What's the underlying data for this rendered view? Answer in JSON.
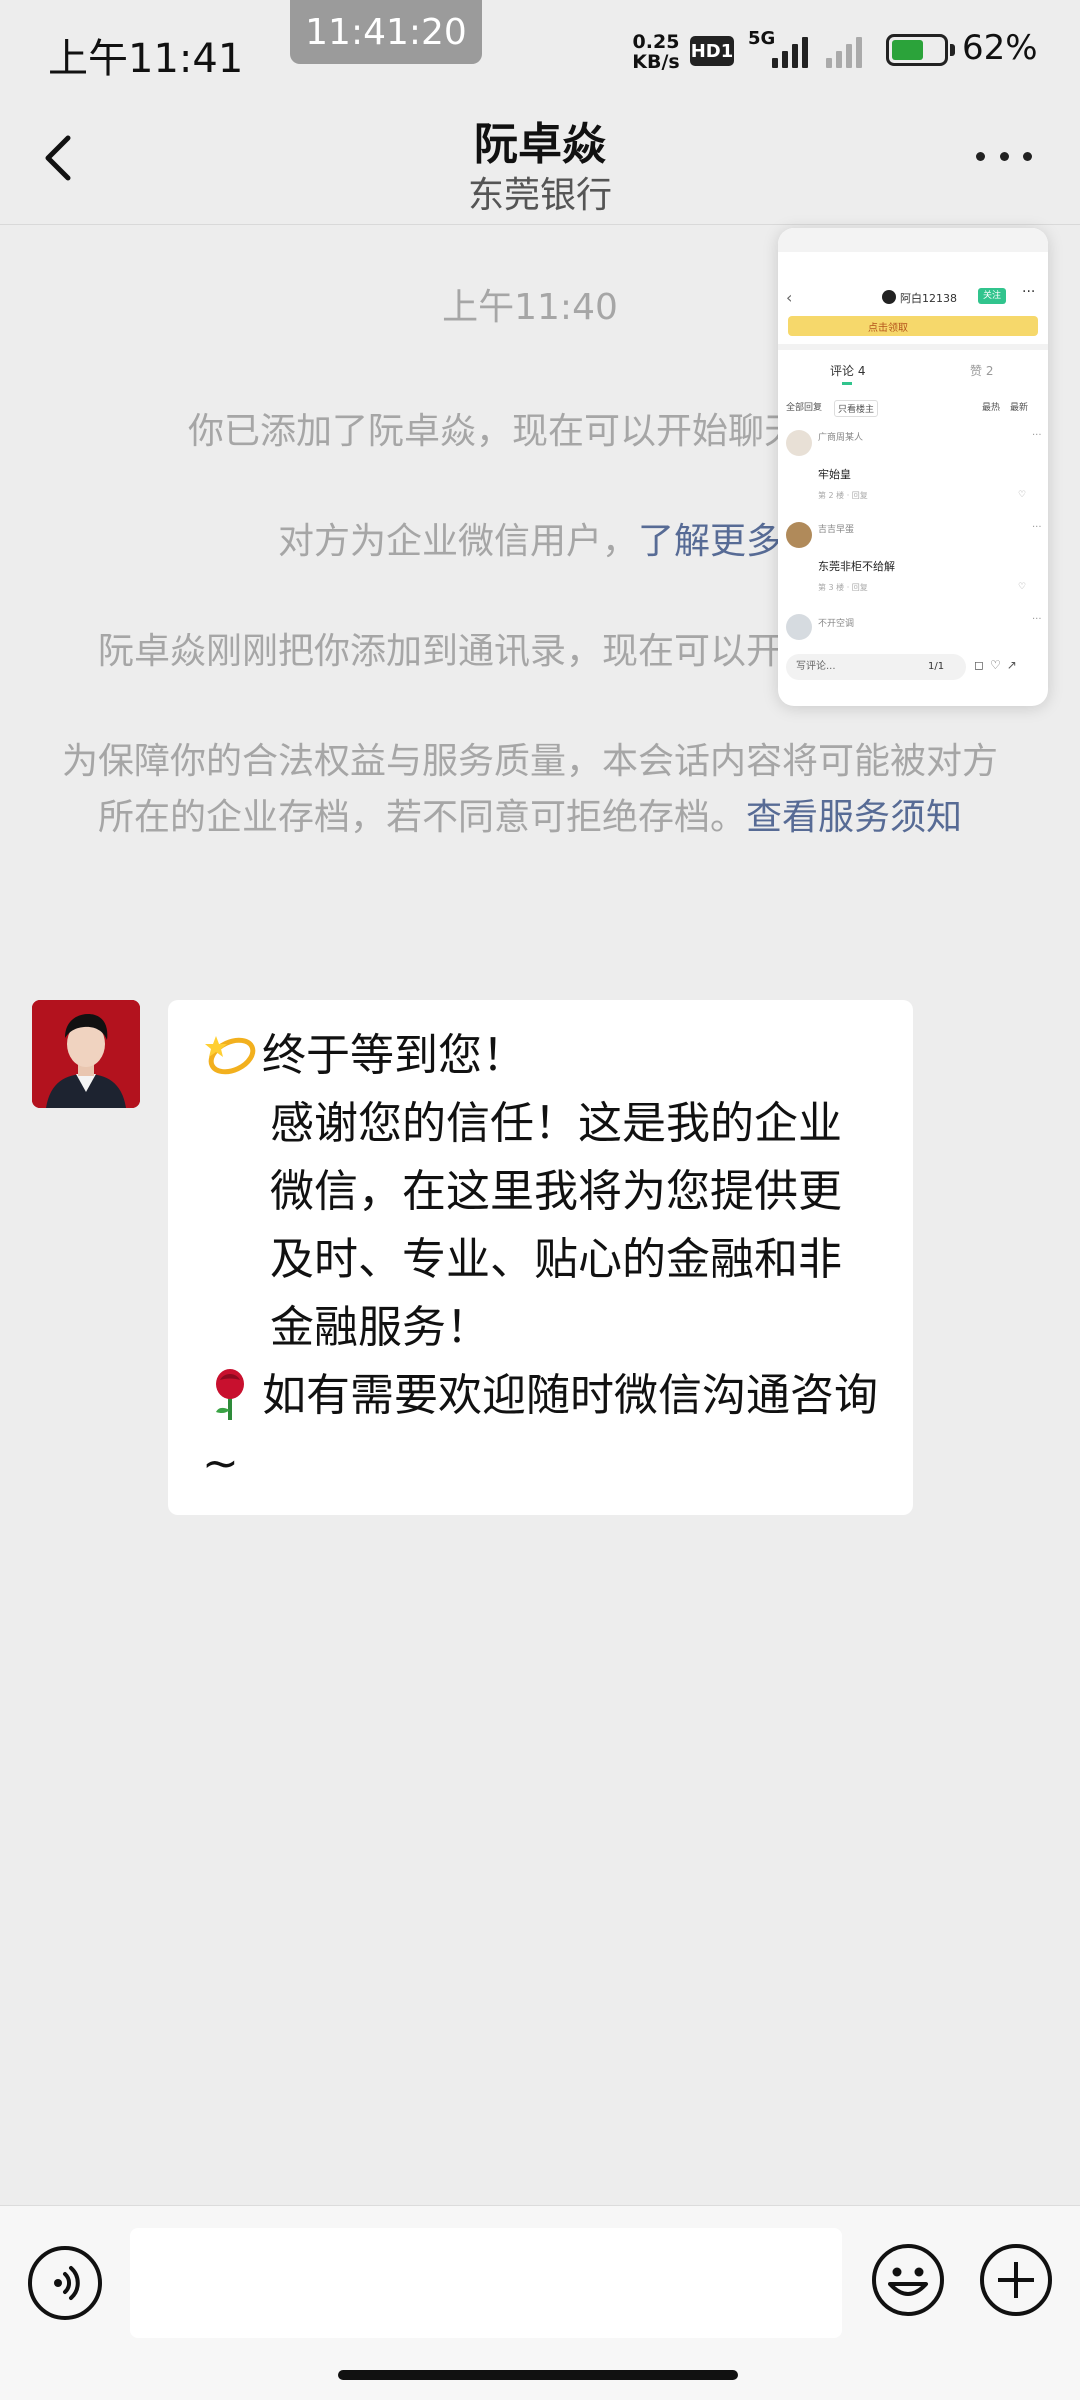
{
  "status_bar": {
    "time": "上午11:41",
    "clock_overlay": "11:41:20",
    "net_speed_value": "0.25",
    "net_speed_unit": "KB/s",
    "hd_badge": "HD1",
    "network_type": "5G",
    "battery_percent": "62%",
    "battery_level": 0.62
  },
  "header": {
    "title": "阮卓焱",
    "subtitle": "东莞银行"
  },
  "system_messages": {
    "timestamp": "上午11:40",
    "added_text": "你已添加了阮卓焱，现在可以开始聊天了。",
    "enterprise_prefix": "对方为企业微信用户，",
    "enterprise_link": "了解更多",
    "contact_added_text": "阮卓焱刚刚把你添加到通讯录，现在可以开始聊天了。",
    "archive_text": "为保障你的合法权益与服务质量，本会话内容将可能被对方所在的企业存档，若不同意可拒绝存档。",
    "archive_link": "查看服务须知"
  },
  "message": {
    "line1": "终于等到您！",
    "line2": "感谢您的信任！这是我的企业微信，在这里我将为您提供更及时、专业、贴心的金融和非金融服务！",
    "line3": "如有需要欢迎随时微信沟通咨询~"
  },
  "floating_window": {
    "username": "阿白12138",
    "follow_label": "关注",
    "banner_text": "点击领取",
    "tab_comments": "评论 4",
    "tab_likes": "赞 2",
    "filter_all": "全部回复",
    "filter_author": "只看楼主",
    "sort_hot": "最热",
    "sort_new": "最新",
    "comments": [
      {
        "name": "广商周某人",
        "text": "牢始皇",
        "meta": "第 2 楼 · 回复"
      },
      {
        "name": "吉吉早蛋",
        "text": "东莞非柜不给解",
        "meta": "第 3 楼 · 回复"
      },
      {
        "name": "不开空调",
        "text": "",
        "meta": ""
      }
    ],
    "input_placeholder": "写评论...",
    "page_indicator": "1/1"
  },
  "icons": {
    "back": "chevron-left-icon",
    "more": "more-dots-icon",
    "voice": "voice-icon",
    "emoji": "smiley-icon",
    "plus": "plus-circle-icon"
  },
  "colors": {
    "background": "#ededed",
    "link": "#576b95",
    "system_text": "#a6a6a6",
    "battery_fill": "#2ba33a",
    "follow_button": "#31c48d"
  }
}
